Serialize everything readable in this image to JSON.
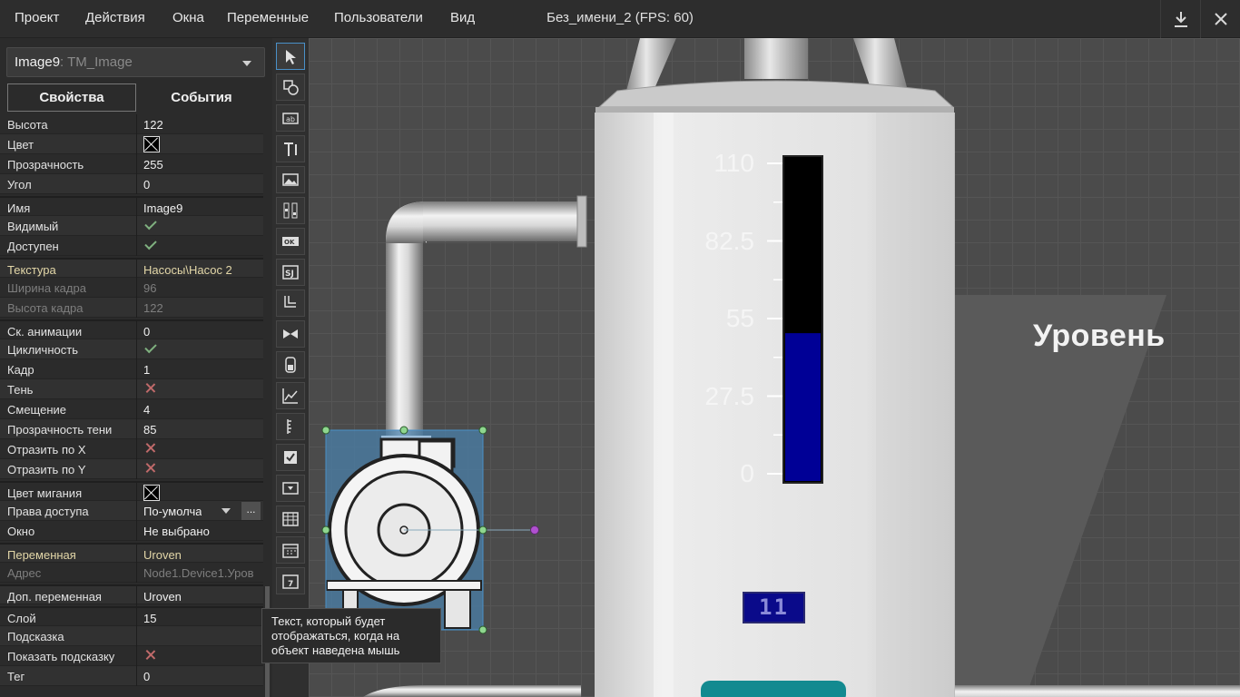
{
  "menu": {
    "items": [
      "Проект",
      "Действия",
      "Окна",
      "Переменные",
      "Пользователи",
      "Вид"
    ],
    "title": "Без_имени_2   (FPS: 60)"
  },
  "inspector": {
    "object_name": "Image9",
    "object_type": ": TM_Image",
    "tab_properties": "Свойства",
    "tab_events": "События",
    "properties": [
      {
        "name": "Высота",
        "value": "122",
        "kind": "text"
      },
      {
        "name": "Цвет",
        "value": "",
        "kind": "color",
        "color": "#000000"
      },
      {
        "name": "Прозрачность",
        "value": "255",
        "kind": "text"
      },
      {
        "name": "Угол",
        "value": "0",
        "kind": "text"
      },
      {
        "name": "Имя",
        "value": "Image9",
        "kind": "text"
      },
      {
        "name": "Видимый",
        "value": "",
        "kind": "check"
      },
      {
        "name": "Доступен",
        "value": "",
        "kind": "check"
      },
      {
        "name": "Текстура",
        "value": "Насосы\\Насос 2",
        "kind": "text",
        "style": "highlight"
      },
      {
        "name": "Ширина кадра",
        "value": "96",
        "kind": "text",
        "style": "dim"
      },
      {
        "name": "Высота кадра",
        "value": "122",
        "kind": "text",
        "style": "dim"
      },
      {
        "name": "Ск. анимации",
        "value": "0",
        "kind": "text"
      },
      {
        "name": "Цикличность",
        "value": "",
        "kind": "check"
      },
      {
        "name": "Кадр",
        "value": "1",
        "kind": "text"
      },
      {
        "name": "Тень",
        "value": "",
        "kind": "cross"
      },
      {
        "name": "Смещение",
        "value": "4",
        "kind": "text"
      },
      {
        "name": "Прозрачность тени",
        "value": "85",
        "kind": "text"
      },
      {
        "name": "Отразить по X",
        "value": "",
        "kind": "cross"
      },
      {
        "name": "Отразить по Y",
        "value": "",
        "kind": "cross"
      },
      {
        "name": "Цвет мигания",
        "value": "",
        "kind": "color",
        "color": "#000000"
      },
      {
        "name": "Права доступа",
        "value": "По-умолча",
        "kind": "dropdown",
        "button": "..."
      },
      {
        "name": "Окно",
        "value": "Не выбрано",
        "kind": "text"
      },
      {
        "name": "Переменная",
        "value": "Uroven",
        "kind": "text",
        "style": "highlight"
      },
      {
        "name": "Адрес",
        "value": "Node1.Device1.Уров",
        "kind": "text",
        "style": "dim"
      },
      {
        "name": "Доп. переменная",
        "value": "Uroven",
        "kind": "text"
      },
      {
        "name": "Слой",
        "value": "15",
        "kind": "text"
      },
      {
        "name": "Подсказка",
        "value": "",
        "kind": "text"
      },
      {
        "name": "Показать подсказку",
        "value": "",
        "kind": "cross"
      },
      {
        "name": "Тег",
        "value": "0",
        "kind": "text"
      }
    ]
  },
  "tools": [
    "pointer-icon",
    "shape-icon",
    "text-field-icon",
    "label-icon",
    "image-icon",
    "slider-icon",
    "ok-button-icon",
    "symbol-icon",
    "pipe-icon",
    "valve-icon",
    "tank-icon",
    "trend-icon",
    "scale-icon",
    "checkbox-icon",
    "combobox-icon",
    "table-icon",
    "calendar-icon",
    "date-icon"
  ],
  "tooltip": "Текст, который будет отображаться, когда на объект наведена мышь",
  "scene": {
    "level_label": "Уровень",
    "scale_ticks": [
      "110",
      "82.5",
      "55",
      "27.5",
      "0"
    ],
    "level_fraction": 0.455,
    "digit_display": "11",
    "colors": {
      "fill": "#000096",
      "empty": "#000000",
      "selection": "#4a90c8",
      "handle": "#8fd68f"
    }
  }
}
